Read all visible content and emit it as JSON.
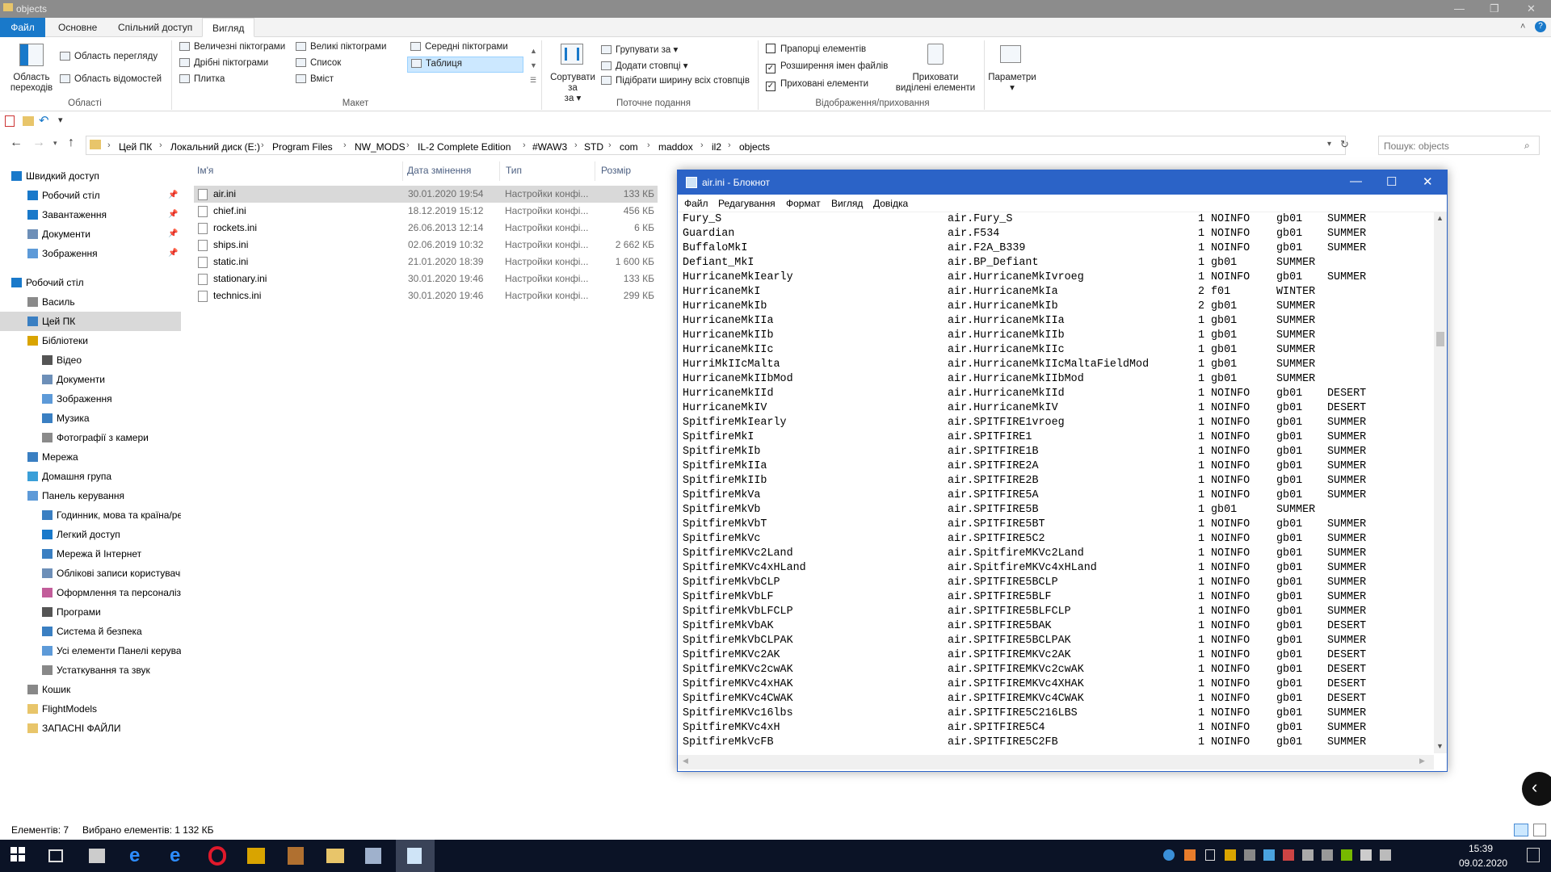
{
  "window": {
    "title": "objects"
  },
  "ribbon_tabs": [
    "Файл",
    "Основне",
    "Спільний доступ",
    "Вигляд"
  ],
  "ribbon": {
    "panes": {
      "nav_pane": "Область переходів",
      "preview": "Область перегляду",
      "details": "Область відомостей",
      "group": "Області"
    },
    "layout": {
      "huge": "Величезні піктограми",
      "large": "Великі піктограми",
      "medium": "Середні піктограми",
      "small": "Дрібні піктограми",
      "list": "Список",
      "table": "Таблиця",
      "tiles": "Плитка",
      "content": "Вміст",
      "group": "Макет"
    },
    "view": {
      "sort": "Сортувати за",
      "group_by": "Групувати за",
      "add_cols": "Додати стовпці",
      "fit_cols": "Підібрати ширину всіх стовпців",
      "group": "Поточне подання"
    },
    "showhide": {
      "checkboxes": "Прапорці елементів",
      "extensions": "Розширення імен файлів",
      "hidden": "Приховані елементи",
      "hide_sel": "Приховати виділені елементи",
      "group": "Відображення/приховання"
    },
    "options": "Параметри"
  },
  "breadcrumbs": [
    "Цей ПК",
    "Локальний диск (E:)",
    "Program Files",
    "NW_MODS",
    "IL-2 Complete Edition",
    "#WAW3",
    "STD",
    "com",
    "maddox",
    "il2",
    "objects"
  ],
  "search": {
    "placeholder": "Пошук: objects"
  },
  "nav_items": [
    {
      "label": "Швидкий доступ"
    },
    {
      "label": "Робочий стіл"
    },
    {
      "label": "Завантаження"
    },
    {
      "label": "Документи"
    },
    {
      "label": "Зображення"
    },
    {
      "label": "Робочий стіл"
    },
    {
      "label": "Василь"
    },
    {
      "label": "Цей ПК"
    },
    {
      "label": "Бібліотеки"
    },
    {
      "label": "Відео"
    },
    {
      "label": "Документи"
    },
    {
      "label": "Зображення"
    },
    {
      "label": "Музика"
    },
    {
      "label": "Фотографії з камери"
    },
    {
      "label": "Мережа"
    },
    {
      "label": "Домашня група"
    },
    {
      "label": "Панель керування"
    },
    {
      "label": "Годинник, мова та країна/рег"
    },
    {
      "label": "Легкий доступ"
    },
    {
      "label": "Мережа й Інтернет"
    },
    {
      "label": "Облікові записи користувачів"
    },
    {
      "label": "Оформлення та персоналізац"
    },
    {
      "label": "Програми"
    },
    {
      "label": "Система й безпека"
    },
    {
      "label": "Усі елементи Панелі керуванн"
    },
    {
      "label": "Устаткування та звук"
    },
    {
      "label": "Кошик"
    },
    {
      "label": "FlightModels"
    },
    {
      "label": "ЗАПАСНІ ФАЙЛИ"
    }
  ],
  "columns": {
    "name": "Ім'я",
    "date": "Дата змінення",
    "type": "Тип",
    "size": "Розмір"
  },
  "files": [
    {
      "name": "air.ini",
      "date": "30.01.2020 19:54",
      "type": "Настройки конфі...",
      "size": "133 КБ"
    },
    {
      "name": "chief.ini",
      "date": "18.12.2019 15:12",
      "type": "Настройки конфі...",
      "size": "456 КБ"
    },
    {
      "name": "rockets.ini",
      "date": "26.06.2013 12:14",
      "type": "Настройки конфі...",
      "size": "6 КБ"
    },
    {
      "name": "ships.ini",
      "date": "02.06.2019 10:32",
      "type": "Настройки конфі...",
      "size": "2 662 КБ"
    },
    {
      "name": "static.ini",
      "date": "21.01.2020 18:39",
      "type": "Настройки конфі...",
      "size": "1 600 КБ"
    },
    {
      "name": "stationary.ini",
      "date": "30.01.2020 19:46",
      "type": "Настройки конфі...",
      "size": "133 КБ"
    },
    {
      "name": "technics.ini",
      "date": "30.01.2020 19:46",
      "type": "Настройки конфі...",
      "size": "299 КБ"
    }
  ],
  "status": {
    "count": "Елементів: 7",
    "selected": "Вибрано елементів: 1  132 КБ"
  },
  "notepad": {
    "title": "air.ini - Блокнот",
    "menu": [
      "Файл",
      "Редагування",
      "Формат",
      "Вигляд",
      "Довідка"
    ],
    "lines": [
      [
        "Fury_S",
        "air.Fury_S",
        "1",
        "NOINFO",
        "gb01",
        "SUMMER"
      ],
      [
        "Guardian",
        "air.F534",
        "1",
        "NOINFO",
        "gb01",
        "SUMMER"
      ],
      [
        "BuffaloMkI",
        "air.F2A_B339",
        "1",
        "NOINFO",
        "gb01",
        "SUMMER"
      ],
      [
        "Defiant_MkI",
        "air.BP_Defiant",
        "1",
        "gb01",
        "SUMMER",
        ""
      ],
      [
        "HurricaneMkIearly",
        "air.HurricaneMkIvroeg",
        "1",
        "NOINFO",
        "gb01",
        "SUMMER"
      ],
      [
        "HurricaneMkI",
        "air.HurricaneMkIa",
        "2",
        "f01",
        "WINTER",
        ""
      ],
      [
        "HurricaneMkIb",
        "air.HurricaneMkIb",
        "2",
        "gb01",
        "SUMMER",
        ""
      ],
      [
        "HurricaneMkIIa",
        "air.HurricaneMkIIa",
        "1",
        "gb01",
        "SUMMER",
        ""
      ],
      [
        "HurricaneMkIIb",
        "air.HurricaneMkIIb",
        "1",
        "gb01",
        "SUMMER",
        ""
      ],
      [
        "HurricaneMkIIc",
        "air.HurricaneMkIIc",
        "1",
        "gb01",
        "SUMMER",
        ""
      ],
      [
        "HurriMkIIcMalta",
        "air.HurricaneMkIIcMaltaFieldMod",
        "1",
        "gb01",
        "SUMMER",
        ""
      ],
      [
        "HurricaneMkIIbMod",
        "air.HurricaneMkIIbMod",
        "1",
        "gb01",
        "SUMMER",
        ""
      ],
      [
        "HurricaneMkIId",
        "air.HurricaneMkIId",
        "1",
        "NOINFO",
        "gb01",
        "DESERT"
      ],
      [
        "HurricaneMkIV",
        "air.HurricaneMkIV",
        "1",
        "NOINFO",
        "gb01",
        "DESERT"
      ],
      [
        "SpitfireMkIearly",
        "air.SPITFIRE1vroeg",
        "1",
        "NOINFO",
        "gb01",
        "SUMMER"
      ],
      [
        "SpitfireMkI",
        "air.SPITFIRE1",
        "1",
        "NOINFO",
        "gb01",
        "SUMMER"
      ],
      [
        "SpitfireMkIb",
        "air.SPITFIRE1B",
        "1",
        "NOINFO",
        "gb01",
        "SUMMER"
      ],
      [
        "SpitfireMkIIa",
        "air.SPITFIRE2A",
        "1",
        "NOINFO",
        "gb01",
        "SUMMER"
      ],
      [
        "SpitfireMkIIb",
        "air.SPITFIRE2B",
        "1",
        "NOINFO",
        "gb01",
        "SUMMER"
      ],
      [
        "SpitfireMkVa",
        "air.SPITFIRE5A",
        "1",
        "NOINFO",
        "gb01",
        "SUMMER"
      ],
      [
        "SpitfireMkVb",
        "air.SPITFIRE5B",
        "1",
        "gb01",
        "SUMMER",
        ""
      ],
      [
        "SpitfireMkVbT",
        "air.SPITFIRE5BT",
        "1",
        "NOINFO",
        "gb01",
        "SUMMER"
      ],
      [
        "SpitfireMkVc",
        "air.SPITFIRE5C2",
        "1",
        "NOINFO",
        "gb01",
        "SUMMER"
      ],
      [
        "SpitfireMKVc2Land",
        "air.SpitfireMKVc2Land",
        "1",
        "NOINFO",
        "gb01",
        "SUMMER"
      ],
      [
        "SpitfireMKVc4xHLand",
        "air.SpitfireMKVc4xHLand",
        "1",
        "NOINFO",
        "gb01",
        "SUMMER"
      ],
      [
        "SpitfireMkVbCLP",
        "air.SPITFIRE5BCLP",
        "1",
        "NOINFO",
        "gb01",
        "SUMMER"
      ],
      [
        "SpitfireMkVbLF",
        "air.SPITFIRE5BLF",
        "1",
        "NOINFO",
        "gb01",
        "SUMMER"
      ],
      [
        "SpitfireMkVbLFCLP",
        "air.SPITFIRE5BLFCLP",
        "1",
        "NOINFO",
        "gb01",
        "SUMMER"
      ],
      [
        "SpitfireMkVbAK",
        "air.SPITFIRE5BAK",
        "1",
        "NOINFO",
        "gb01",
        "DESERT"
      ],
      [
        "SpitfireMkVbCLPAK",
        "air.SPITFIRE5BCLPAK",
        "1",
        "NOINFO",
        "gb01",
        "SUMMER"
      ],
      [
        "SpitfireMKVc2AK",
        "air.SPITFIREMKVc2AK",
        "1",
        "NOINFO",
        "gb01",
        "DESERT"
      ],
      [
        "SpitfireMKVc2cwAK",
        "air.SPITFIREMKVc2cwAK",
        "1",
        "NOINFO",
        "gb01",
        "DESERT"
      ],
      [
        "SpitfireMKVc4xHAK",
        "air.SPITFIREMKVc4XHAK",
        "1",
        "NOINFO",
        "gb01",
        "DESERT"
      ],
      [
        "SpitfireMKVc4CWAK",
        "air.SPITFIREMKVc4CWAK",
        "1",
        "NOINFO",
        "gb01",
        "DESERT"
      ],
      [
        "SpitfireMKVc16lbs",
        "air.SPITFIRE5C216LBS",
        "1",
        "NOINFO",
        "gb01",
        "SUMMER"
      ],
      [
        "SpitfireMKVc4xH",
        "air.SPITFIRE5C4",
        "1",
        "NOINFO",
        "gb01",
        "SUMMER"
      ],
      [
        "SpitfireMkVcFB",
        "air.SPITFIRE5C2FB",
        "1",
        "NOINFO",
        "gb01",
        "SUMMER"
      ]
    ]
  },
  "clock": {
    "time": "15:39",
    "date": "09.02.2020"
  },
  "colors": {
    "accent": "#1979ca",
    "notepad_title": "#2b63c7",
    "taskbar": "#0b1326"
  }
}
